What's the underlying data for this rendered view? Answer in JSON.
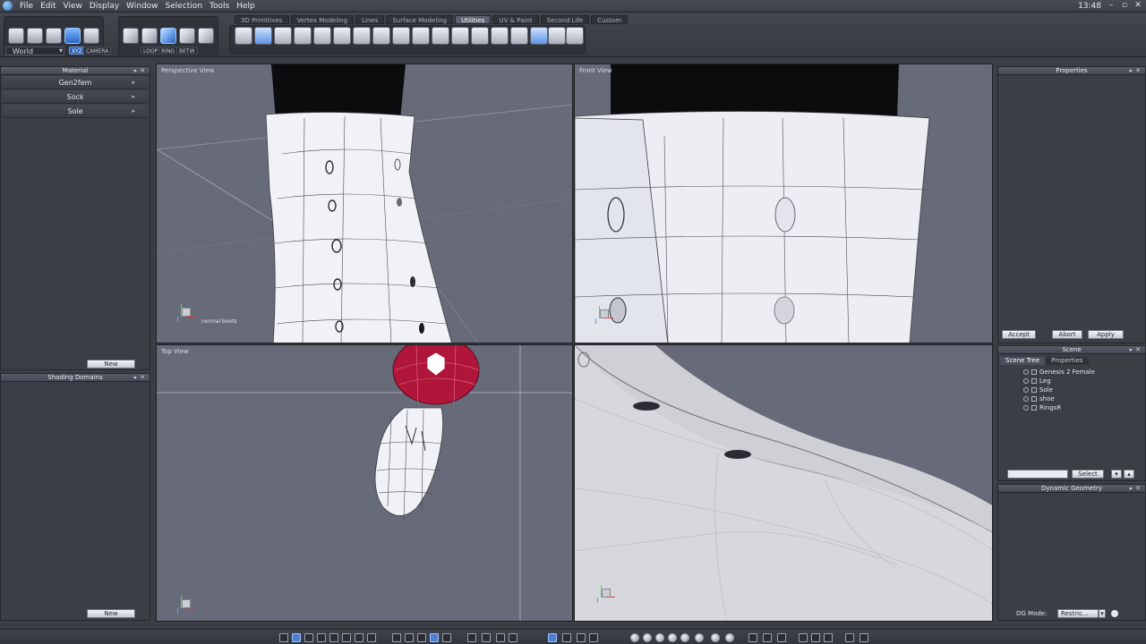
{
  "menubar": {
    "items": [
      "File",
      "Edit",
      "View",
      "Display",
      "Window",
      "Selection",
      "Tools",
      "Help"
    ],
    "clock": "13:48"
  },
  "toolbar": {
    "coord_space": "World",
    "xyz_label": "XYZ",
    "camera_label": "CAMERA",
    "loop_label": "LOOP",
    "ring_label": "RING",
    "betw_label": "BETW",
    "tabs": [
      "3D Primitives",
      "Vertex Modeling",
      "Lines",
      "Surface Modeling",
      "Utilities",
      "UV & Paint",
      "Second Life",
      "Custom"
    ],
    "active_tab": "Utilities"
  },
  "material_panel": {
    "title": "Material",
    "items": [
      "Gen2fem",
      "Sock",
      "Sole"
    ],
    "new_label": "New"
  },
  "shading_panel": {
    "title": "Shading Domains",
    "new_label": "New"
  },
  "viewports": {
    "perspective": {
      "label": "Perspective View",
      "object_label": "normal boots"
    },
    "front": {
      "label": "Front View"
    },
    "top": {
      "label": "Top View"
    }
  },
  "properties_panel": {
    "title": "Properties",
    "accept": "Accept",
    "abort": "Abort",
    "apply": "Apply"
  },
  "scene_panel": {
    "title": "Scene",
    "tabs": [
      "Scene Tree",
      "Properties"
    ],
    "tree": [
      "Genesis 2 Female",
      "Leg",
      "Sole",
      "shoe",
      "RingsR"
    ],
    "select_label": "Select"
  },
  "dynamic_geometry": {
    "title": "Dynamic Geometry",
    "mode_label": "DG Mode:",
    "mode_value": "Restric..."
  },
  "colors": {
    "viewport_bg": "#676a78",
    "accent_blue": "#2b67c6",
    "selection_red": "#b0163a"
  }
}
